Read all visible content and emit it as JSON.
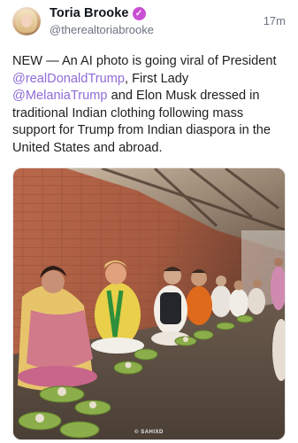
{
  "post": {
    "author": {
      "display_name": "Toria Brooke",
      "handle": "@therealtoriabrooke",
      "verified_icon": "verified-badge-icon",
      "badge_color": "#c94fd3"
    },
    "timestamp": "17m",
    "text": {
      "part1": "NEW — An AI photo is going viral of President ",
      "mention1": "@realDonaldTrump",
      "part2": ", First Lady ",
      "mention2": "@MelaniaTrump",
      "part3": " and Elon Musk dressed in traditional Indian clothing following mass support for Trump from Indian diaspora in the United States and abroad."
    },
    "media": {
      "watermark": "© SAHIXD"
    },
    "colors": {
      "mention": "#8f6bd8",
      "text": "#1f1f1f",
      "secondary": "#6b7280"
    }
  }
}
